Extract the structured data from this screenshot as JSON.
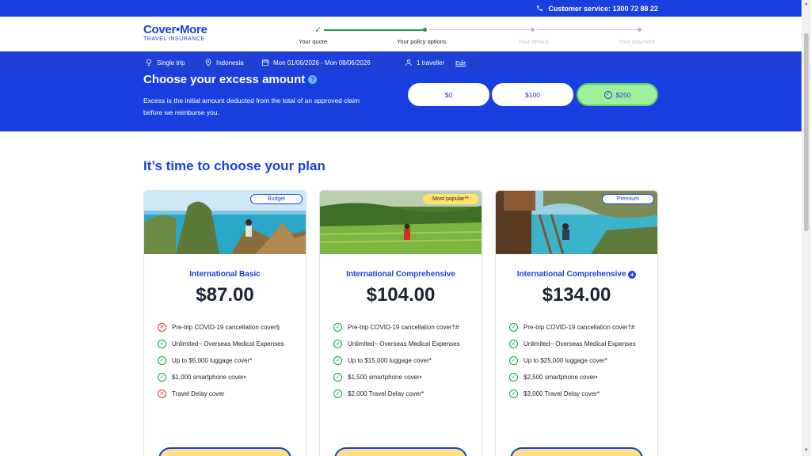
{
  "topbar": {
    "customer_service": "Customer service: 1300 72 88 22"
  },
  "logo": {
    "main": "Cover•More",
    "sub": "TRAVEL INSURANCE"
  },
  "steps": [
    {
      "label": "Your quote",
      "state": "done"
    },
    {
      "label": "Your policy options",
      "state": "current"
    },
    {
      "label": "Your details",
      "state": "upcoming"
    },
    {
      "label": "Your payment",
      "state": "upcoming"
    }
  ],
  "summary": {
    "trip_type": "Single trip",
    "destination": "Indonesia",
    "dates": "Mon 01/06/2026 - Mon 08/06/2026",
    "travellers": "1 traveller",
    "edit": "Edit"
  },
  "excess": {
    "title": "Choose your excess amount",
    "help": "?",
    "description": "Excess is the initial amount deducted from the total of an approved claim before we reimburse you.",
    "options": [
      "$0",
      "$100",
      "$250"
    ],
    "selected": "$250"
  },
  "plans_title": "It’s time to choose your plan",
  "plans": [
    {
      "badge": "Budget",
      "name": "International Basic",
      "price": "$87.00",
      "features": [
        {
          "text": "Pre-trip COVID-19 cancellation cover§",
          "included": false
        },
        {
          "text": "Unlimited~ Overseas Medical Expenses",
          "included": true
        },
        {
          "text": "Up to $5,000 luggage cover*",
          "included": true
        },
        {
          "text": "$1,000 smartphone cover•",
          "included": true
        },
        {
          "text": "Travel Delay cover",
          "included": false
        }
      ]
    },
    {
      "badge": "Most popular**",
      "name": "International Comprehensive",
      "price": "$104.00",
      "features": [
        {
          "text": "Pre-trip COVID-19 cancellation cover†#",
          "included": true
        },
        {
          "text": "Unlimited~ Overseas Medical Expenses",
          "included": true
        },
        {
          "text": "Up to $15,000 luggage cover*",
          "included": true
        },
        {
          "text": "$1,500 smartphone cover•",
          "included": true
        },
        {
          "text": "$2,000 Travel Delay cover*",
          "included": true
        }
      ]
    },
    {
      "badge": "Premium",
      "name": "International Comprehensive",
      "price": "$134.00",
      "features": [
        {
          "text": "Pre-trip COVID-19 cancellation cover†#",
          "included": true
        },
        {
          "text": "Unlimited~ Overseas Medical Expenses",
          "included": true
        },
        {
          "text": "Up to $25,000 luggage cover*",
          "included": true
        },
        {
          "text": "$2,500 smartphone cover•",
          "included": true
        },
        {
          "text": "$3,000 Travel Delay cover*",
          "included": true
        }
      ]
    }
  ],
  "colors": {
    "brand": "#1a3fe0",
    "selected": "#9ff09a",
    "success": "#1f9d4a",
    "error": "#d63a3a"
  }
}
